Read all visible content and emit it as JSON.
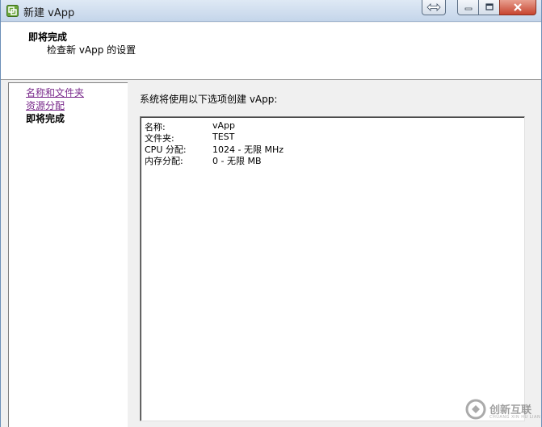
{
  "window": {
    "title": "新建 vApp"
  },
  "header": {
    "title": "即将完成",
    "subtitle": "检查新 vApp 的设置"
  },
  "nav": {
    "items": [
      {
        "label": "名称和文件夹",
        "state": "link"
      },
      {
        "label": "资源分配",
        "state": "link"
      },
      {
        "label": "即将完成",
        "state": "current"
      }
    ]
  },
  "main": {
    "intro": "系统将使用以下选项创建 vApp:",
    "summary": [
      {
        "key": "名称:",
        "value": "vApp"
      },
      {
        "key": "文件夹:",
        "value": "TEST"
      },
      {
        "key": "CPU 分配:",
        "value": "1024 - 无限 MHz"
      },
      {
        "key": "内存分配:",
        "value": "0 - 无限 MB"
      }
    ]
  },
  "watermark": {
    "text": "创新互联",
    "subtext": "CHUANG XIN HU LIAN"
  },
  "colors": {
    "link": "#7a2a8c",
    "titlebar": "#c4d5ea",
    "close": "#c7442f"
  }
}
